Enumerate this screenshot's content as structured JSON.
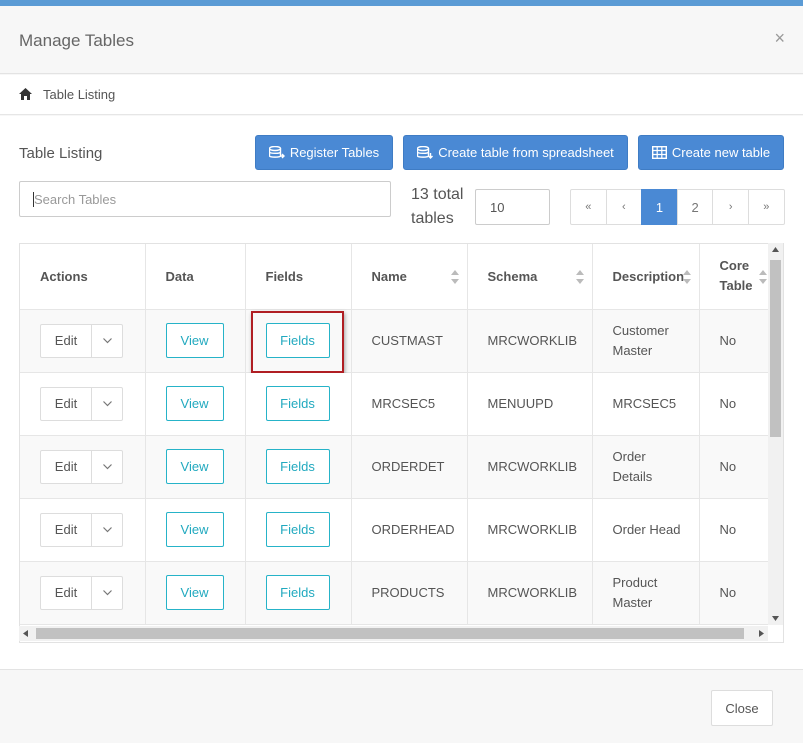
{
  "modal": {
    "title": "Manage Tables",
    "close_glyph": "×"
  },
  "breadcrumb": {
    "icon": "home-icon",
    "label": "Table Listing"
  },
  "toolbar": {
    "section_title": "Table Listing",
    "register_label": "Register Tables",
    "spreadsheet_label": "Create table from spreadsheet",
    "new_table_label": "Create new table"
  },
  "search": {
    "placeholder": "Search Tables",
    "value": ""
  },
  "summary": {
    "total_line1": "13 total",
    "total_line2": "tables",
    "page_size": "10"
  },
  "pager": {
    "first": "«",
    "prev": "‹",
    "page1": "1",
    "page2": "2",
    "next": "›",
    "last": "»"
  },
  "table": {
    "headers": {
      "actions": "Actions",
      "data": "Data",
      "fields": "Fields",
      "name": "Name",
      "schema": "Schema",
      "description_label": "Description",
      "core_line1": "Core",
      "core_line2": "Table"
    },
    "edit_label": "Edit",
    "view_label": "View",
    "fields_label": "Fields",
    "rows": [
      {
        "name": "CUSTMAST",
        "schema": "MRCWORKLIB",
        "desc1": "Customer",
        "desc2": "Master",
        "core": "No"
      },
      {
        "name": "MRCSEC5",
        "schema": "MENUUPD",
        "desc1": "MRCSEC5",
        "desc2": "",
        "core": "No"
      },
      {
        "name": "ORDERDET",
        "schema": "MRCWORKLIB",
        "desc1": "Order",
        "desc2": "Details",
        "core": "No"
      },
      {
        "name": "ORDERHEAD",
        "schema": "MRCWORKLIB",
        "desc1": "Order Head",
        "desc2": "",
        "core": "No"
      },
      {
        "name": "PRODUCTS",
        "schema": "MRCWORKLIB",
        "desc1": "Product",
        "desc2": "Master",
        "core": "No"
      }
    ]
  },
  "footer": {
    "close_label": "Close"
  },
  "colors": {
    "primary": "#4a89d4",
    "outline": "#26b3c8",
    "highlight": "#b01e23",
    "topbar": "#5b9bd5"
  }
}
